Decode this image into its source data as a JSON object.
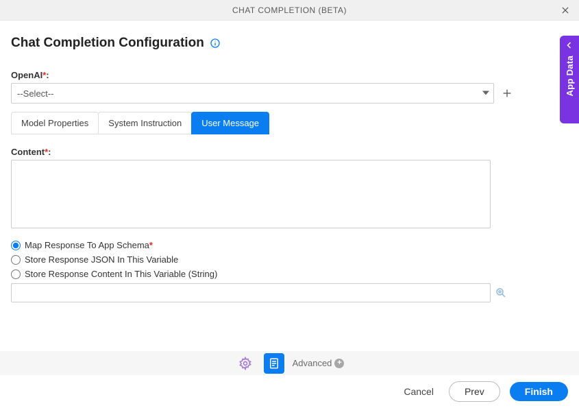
{
  "dialog": {
    "title": "CHAT COMPLETION (BETA)"
  },
  "header": {
    "title": "Chat Completion Configuration"
  },
  "fields": {
    "openai_label": "OpenAI",
    "openai_colon": ":",
    "openai_value": "--Select--",
    "content_label": "Content",
    "content_colon": ":",
    "content_value": "",
    "variable_value": ""
  },
  "tabs": {
    "model_properties": "Model Properties",
    "system_instruction": "System Instruction",
    "user_message": "User Message",
    "active": "user_message"
  },
  "radios": {
    "group": "resp",
    "map_schema": {
      "label": "Map Response To App Schema",
      "checked": true
    },
    "store_json": {
      "label": "Store Response JSON In This Variable",
      "checked": false
    },
    "store_content": {
      "label": "Store Response Content In This Variable (String)",
      "checked": false
    }
  },
  "bottom": {
    "advanced_label": "Advanced"
  },
  "footer": {
    "cancel": "Cancel",
    "prev": "Prev",
    "finish": "Finish"
  },
  "side_tab": {
    "label": "App Data"
  },
  "colors": {
    "accent": "#0a7ef0",
    "side": "#7a33e0"
  }
}
